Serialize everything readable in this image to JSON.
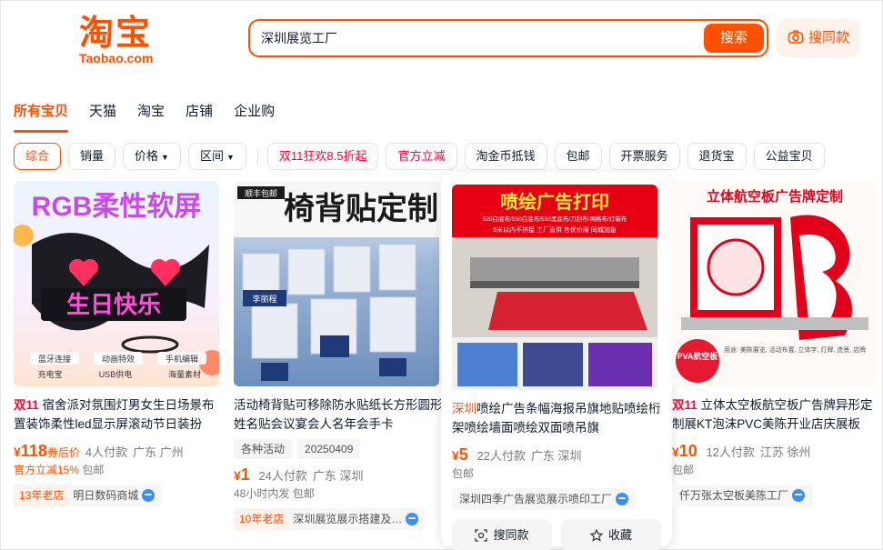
{
  "header": {
    "logo_cn": "淘宝",
    "logo_en": "Taobao.com",
    "search_value": "深圳展览工厂",
    "search_button": "搜索",
    "image_search_button": "搜同款"
  },
  "tabs": [
    {
      "label": "所有宝贝",
      "active": true
    },
    {
      "label": "天猫"
    },
    {
      "label": "淘宝"
    },
    {
      "label": "店铺"
    },
    {
      "label": "企业购"
    }
  ],
  "filters": {
    "sort": [
      "综合",
      "销量",
      "价格",
      "区间"
    ],
    "promos": [
      "双11狂欢8.5折起",
      "官方立减"
    ],
    "services": [
      "淘金币抵钱",
      "包邮",
      "开票服务",
      "退货宝",
      "公益宝贝"
    ]
  },
  "products": [
    {
      "image_title": "RGB柔性软屏",
      "image_badges": [
        "蓝牙连接",
        "动画特效",
        "手机编辑",
        "充电宝",
        "USB供电",
        "海量素材"
      ],
      "image_screen_text": "生日快乐",
      "tag": "双11",
      "title": "宿舍派对氛围灯男女生日场景布置装饰柔性led显示屏滚动节日装扮",
      "price": "118",
      "price_suffix": "券后价",
      "sold": "4人付款",
      "location": "广东 广州",
      "note": "官方立减15%",
      "note2": "包邮",
      "shop_badge": "13年老店",
      "shop": "明日数码商城"
    },
    {
      "image_title": "椅背贴定制",
      "image_corner": "顺丰包邮",
      "image_name_card": "李丽程",
      "title": "活动椅背贴可移除防水贴纸长方形圆形姓名贴会议宴会人名年会手卡",
      "tags": [
        "各种活动",
        "20250409"
      ],
      "price": "1",
      "sold": "24人付款",
      "location": "广东 深圳",
      "note": "48小时内发",
      "note2": "包邮",
      "shop_badge": "10年老店",
      "shop": "深圳展览展示搭建及…"
    },
    {
      "image_title": "喷绘广告打印",
      "image_sub1": "520白底布/550白底布/550黑底布/刀刮布/网格布/灯箱布",
      "image_sub2": "5米以内不拼接  工厂直供  售优价廉  同城加急",
      "title_highlight": "深圳",
      "title": "喷绘广告条幅海报吊旗地贴喷绘桁架喷绘墙面喷绘双面喷吊旗",
      "price": "5",
      "sold": "22人付款",
      "location": "广东 深圳",
      "note2": "包邮",
      "shop": "深圳四季广告展览展示喷印工厂",
      "actions": [
        "搜同款",
        "收藏"
      ]
    },
    {
      "image_title": "立体航空板广告牌定制",
      "image_badge": "PVA航空板",
      "image_caption": "用途: 美陈展览, 活动布置, 立体字, 灯牌, 造景, 店牌",
      "tag": "双11",
      "title": "立体太空板航空板广告牌异形定制展KT泡沫PVC美陈开业店庆展板",
      "price": "10",
      "sold": "12人付款",
      "location": "江苏 徐州",
      "note2": "包邮",
      "shop": "仟万张太空板美陈工厂"
    }
  ],
  "colors": {
    "accent": "#ff5000",
    "promo_red": "#ff0036",
    "wangwang_blue": "#3d8ef7"
  }
}
